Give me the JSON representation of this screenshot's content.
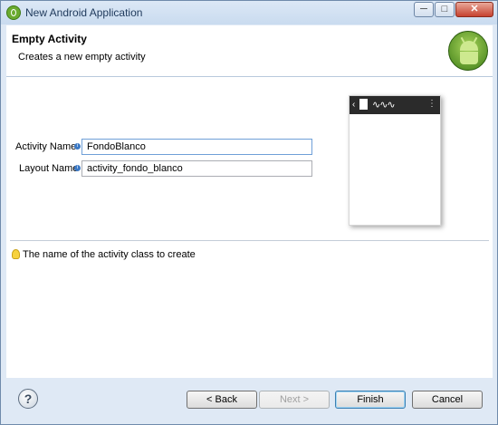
{
  "window": {
    "title": "New Android Application",
    "controls": {
      "minimize": "─",
      "maximize": "□",
      "close": "✕"
    }
  },
  "header": {
    "title": "Empty Activity",
    "description": "Creates a new empty activity",
    "logo_icon": "android-logo-icon"
  },
  "form": {
    "activity_name": {
      "label": "Activity Name",
      "value": "FondoBlanco"
    },
    "layout_name": {
      "label": "Layout Name",
      "value": "activity_fondo_blanco"
    }
  },
  "preview": {
    "back_glyph": "‹",
    "wave_glyph": "∿∿∿",
    "menu_glyph": "⋮"
  },
  "hint": {
    "text": "The name of the activity class to create",
    "icon": "lightbulb-icon"
  },
  "footer": {
    "help_label": "?",
    "back_label": "< Back",
    "next_label": "Next >",
    "finish_label": "Finish",
    "cancel_label": "Cancel"
  },
  "colors": {
    "accent": "#3c7fb1",
    "frame": "#dfe9f5",
    "android_green": "#6bab2f"
  }
}
